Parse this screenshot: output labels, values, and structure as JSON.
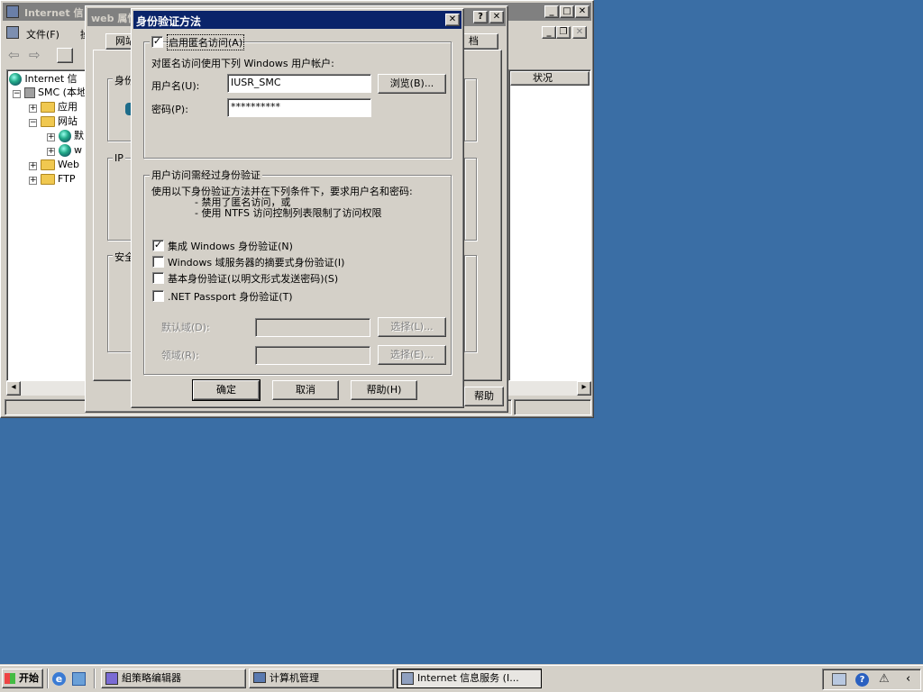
{
  "iis_window": {
    "title": "Internet 信",
    "menu_file": "文件(F)",
    "menu_action": "操",
    "tree": [
      "Internet 信",
      "SMC (本地",
      "应用",
      "网站",
      "默",
      "w",
      "Web",
      "FTP"
    ],
    "col_status": "状况"
  },
  "web_props": {
    "title": "web 属性",
    "tab_left": "网站",
    "tab_right": "档",
    "section_identity": "身份",
    "section_ip": "IP",
    "section_security": "安全",
    "help_label": "帮助"
  },
  "auth_dialog": {
    "title": "身份验证方法",
    "enable_anonymous": "启用匿名访问(A)",
    "anonymous_checked": true,
    "anon_desc": "对匿名访问使用下列 Windows 用户帐户:",
    "username_label": "用户名(U):",
    "username_value": "IUSR_SMC",
    "browse_btn": "浏览(B)...",
    "password_label": "密码(P):",
    "password_value": "**********",
    "auth_group_label": "用户访问需经过身份验证",
    "auth_desc_1": "使用以下身份验证方法并在下列条件下，要求用户名和密码:",
    "auth_desc_2": "- 禁用了匿名访问，或",
    "auth_desc_3": "- 使用 NTFS 访问控制列表限制了访问权限",
    "options": [
      {
        "label": "集成 Windows 身份验证(N)",
        "checked": true
      },
      {
        "label": "Windows 域服务器的摘要式身份验证(I)",
        "checked": false
      },
      {
        "label": "基本身份验证(以明文形式发送密码)(S)",
        "checked": false
      },
      {
        "label": ".NET Passport 身份验证(T)",
        "checked": false
      }
    ],
    "default_domain_label": "默认域(D):",
    "realm_label": "领域(R):",
    "select_btn_1": "选择(L)...",
    "select_btn_2": "选择(E)...",
    "ok_btn": "确定",
    "cancel_btn": "取消",
    "help_btn": "帮助(H)"
  },
  "taskbar": {
    "start": "开始",
    "items": [
      "組策略编辑器",
      "计算机管理",
      "Internet 信息服务 (I..."
    ]
  },
  "colors": {
    "desktop": "#3a6ea5",
    "face": "#d4d0c8",
    "active_title": "#0a246a",
    "inactive_title": "#808080"
  }
}
